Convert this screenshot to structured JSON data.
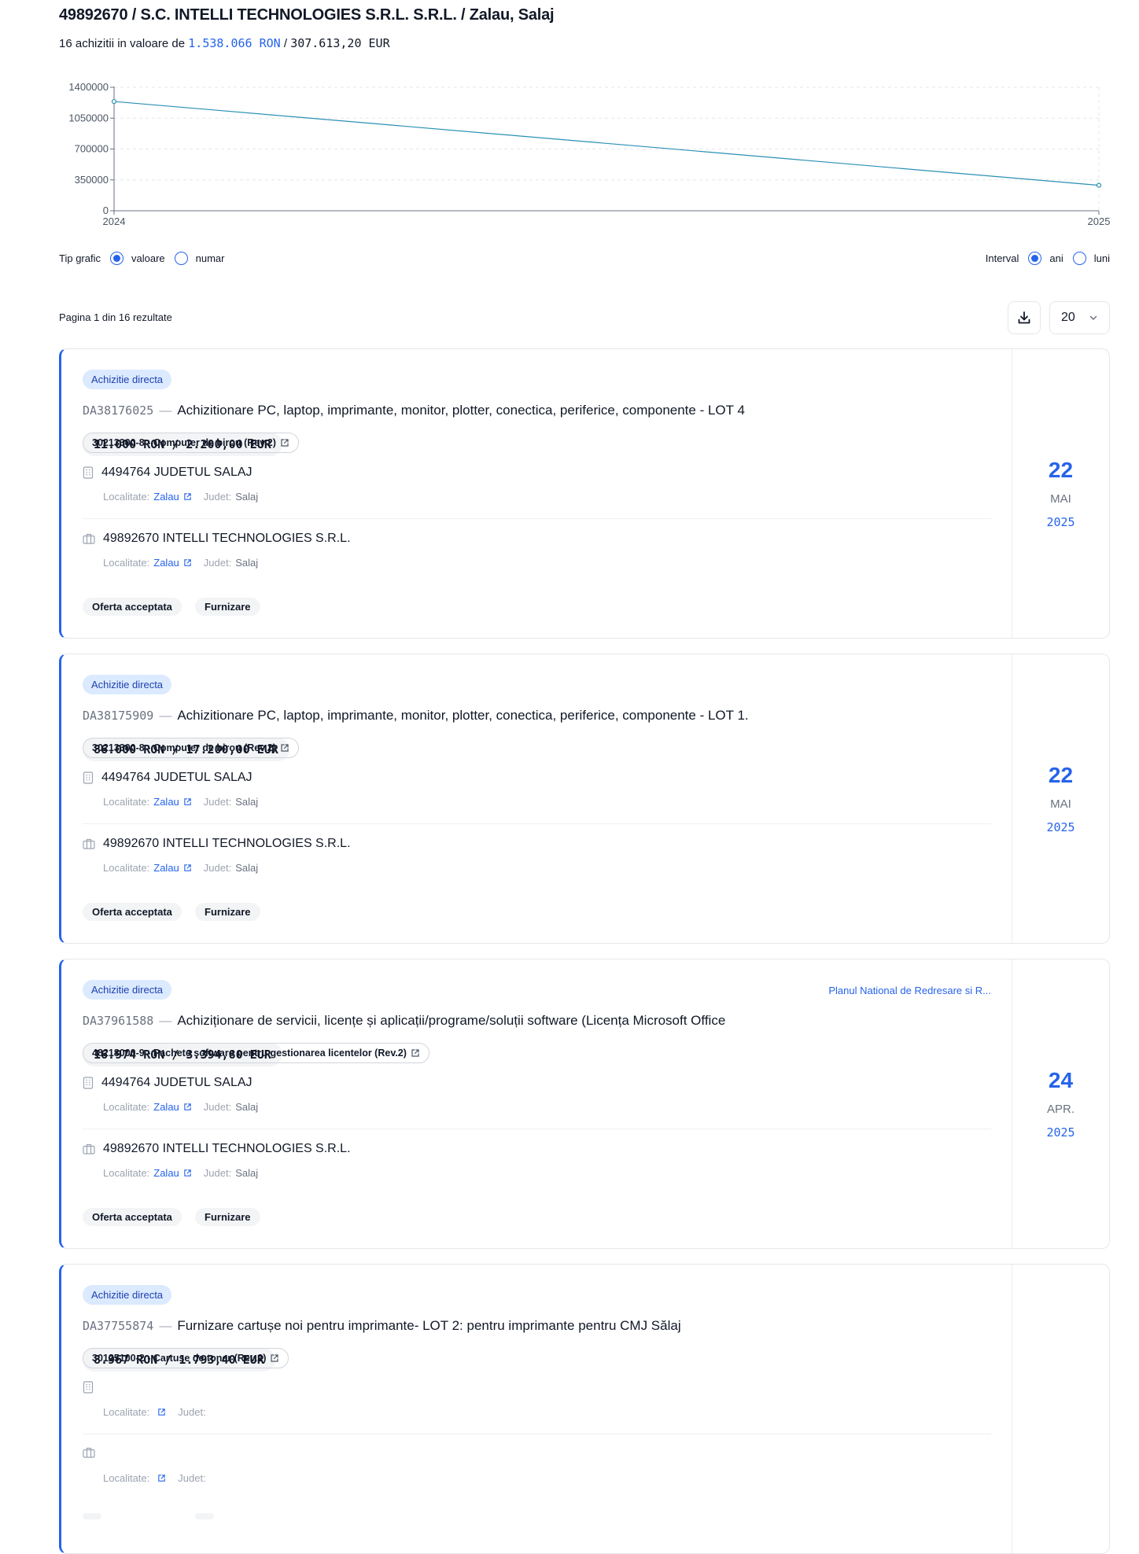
{
  "header": {
    "title": "49892670 / S.C. INTELLI TECHNOLOGIES S.R.L. S.R.L. / Zalau, Salaj",
    "summary_prefix": "16 achizitii in valoare de",
    "total_ron": "1.538.066 RON",
    "summary_sep": "/",
    "total_eur": "307.613,20 EUR"
  },
  "chart_data": {
    "type": "line",
    "x": [
      "2024",
      "2025"
    ],
    "series": [
      {
        "values": [
          1239000,
          289000
        ]
      }
    ],
    "yticks": [
      0,
      350000,
      700000,
      1050000,
      1400000
    ],
    "ylim": [
      0,
      1400000
    ],
    "grid": true,
    "color": "#2a8fb4"
  },
  "controls": {
    "chart_type_label": "Tip grafic",
    "opt_value": "valoare",
    "opt_number": "numar",
    "interval_label": "Interval",
    "opt_years": "ani",
    "opt_months": "luni"
  },
  "pagination": {
    "info": "Pagina 1 din 16 rezultate",
    "per_page": "20"
  },
  "labels": {
    "localitate": "Localitate:",
    "judet": "Judet:"
  },
  "cards": [
    {
      "badge": "Achizitie directa",
      "program": "",
      "code": "DA38176025",
      "dash": "—",
      "title": "Achizitionare PC, laptop, imprimante, monitor, plotter, conectica, periferice, componente - LOT 4",
      "amount": "11.000 RON / 2.200,00 EUR",
      "cpv": "30213300-8 - Computer de birou (Rev.2)",
      "authority": "4494764 JUDETUL SALAJ",
      "authority_city": "Zalau",
      "authority_county": "Salaj",
      "supplier": "49892670 INTELLI TECHNOLOGIES S.R.L.",
      "supplier_city": "Zalau",
      "supplier_county": "Salaj",
      "status": "Oferta acceptata",
      "kind": "Furnizare",
      "day": "22",
      "month": "MAI",
      "year": "2025"
    },
    {
      "badge": "Achizitie directa",
      "program": "",
      "code": "DA38175909",
      "dash": "—",
      "title": "Achizitionare PC, laptop, imprimante, monitor, plotter, conectica, periferice, componente - LOT 1.",
      "amount": "86.000 RON / 17.200,00 EUR",
      "cpv": "30213300-8 - Computer de birou (Rev.2)",
      "authority": "4494764 JUDETUL SALAJ",
      "authority_city": "Zalau",
      "authority_county": "Salaj",
      "supplier": "49892670 INTELLI TECHNOLOGIES S.R.L.",
      "supplier_city": "Zalau",
      "supplier_county": "Salaj",
      "status": "Oferta acceptata",
      "kind": "Furnizare",
      "day": "22",
      "month": "MAI",
      "year": "2025"
    },
    {
      "badge": "Achizitie directa",
      "program": "Planul National de Redresare si R...",
      "code": "DA37961588",
      "dash": "—",
      "title": "Achiziționare de servicii, licențe și aplicații/programe/soluții software (Licența Microsoft Office",
      "amount": "16.974 RON / 3.394,80 EUR",
      "cpv": "48218000-9 - Pachete software pentru gestionarea licentelor (Rev.2)",
      "authority": "4494764 JUDETUL SALAJ",
      "authority_city": "Zalau",
      "authority_county": "Salaj",
      "supplier": "49892670 INTELLI TECHNOLOGIES S.R.L.",
      "supplier_city": "Zalau",
      "supplier_county": "Salaj",
      "status": "Oferta acceptata",
      "kind": "Furnizare",
      "day": "24",
      "month": "APR.",
      "year": "2025"
    },
    {
      "badge": "Achizitie directa",
      "program": "",
      "code": "DA37755874",
      "dash": "—",
      "title": "Furnizare cartușe noi pentru imprimante- LOT 2: pentru imprimante pentru CMJ Sălaj",
      "amount": "8.967 RON / 1.793,40 EUR",
      "cpv": "30125100-2 - Cartuse de toner (Rev.2)",
      "authority": "",
      "authority_city": "",
      "authority_county": "",
      "supplier": "",
      "supplier_city": "",
      "supplier_county": "",
      "status": "",
      "kind": "",
      "day": "",
      "month": "",
      "year": ""
    }
  ]
}
